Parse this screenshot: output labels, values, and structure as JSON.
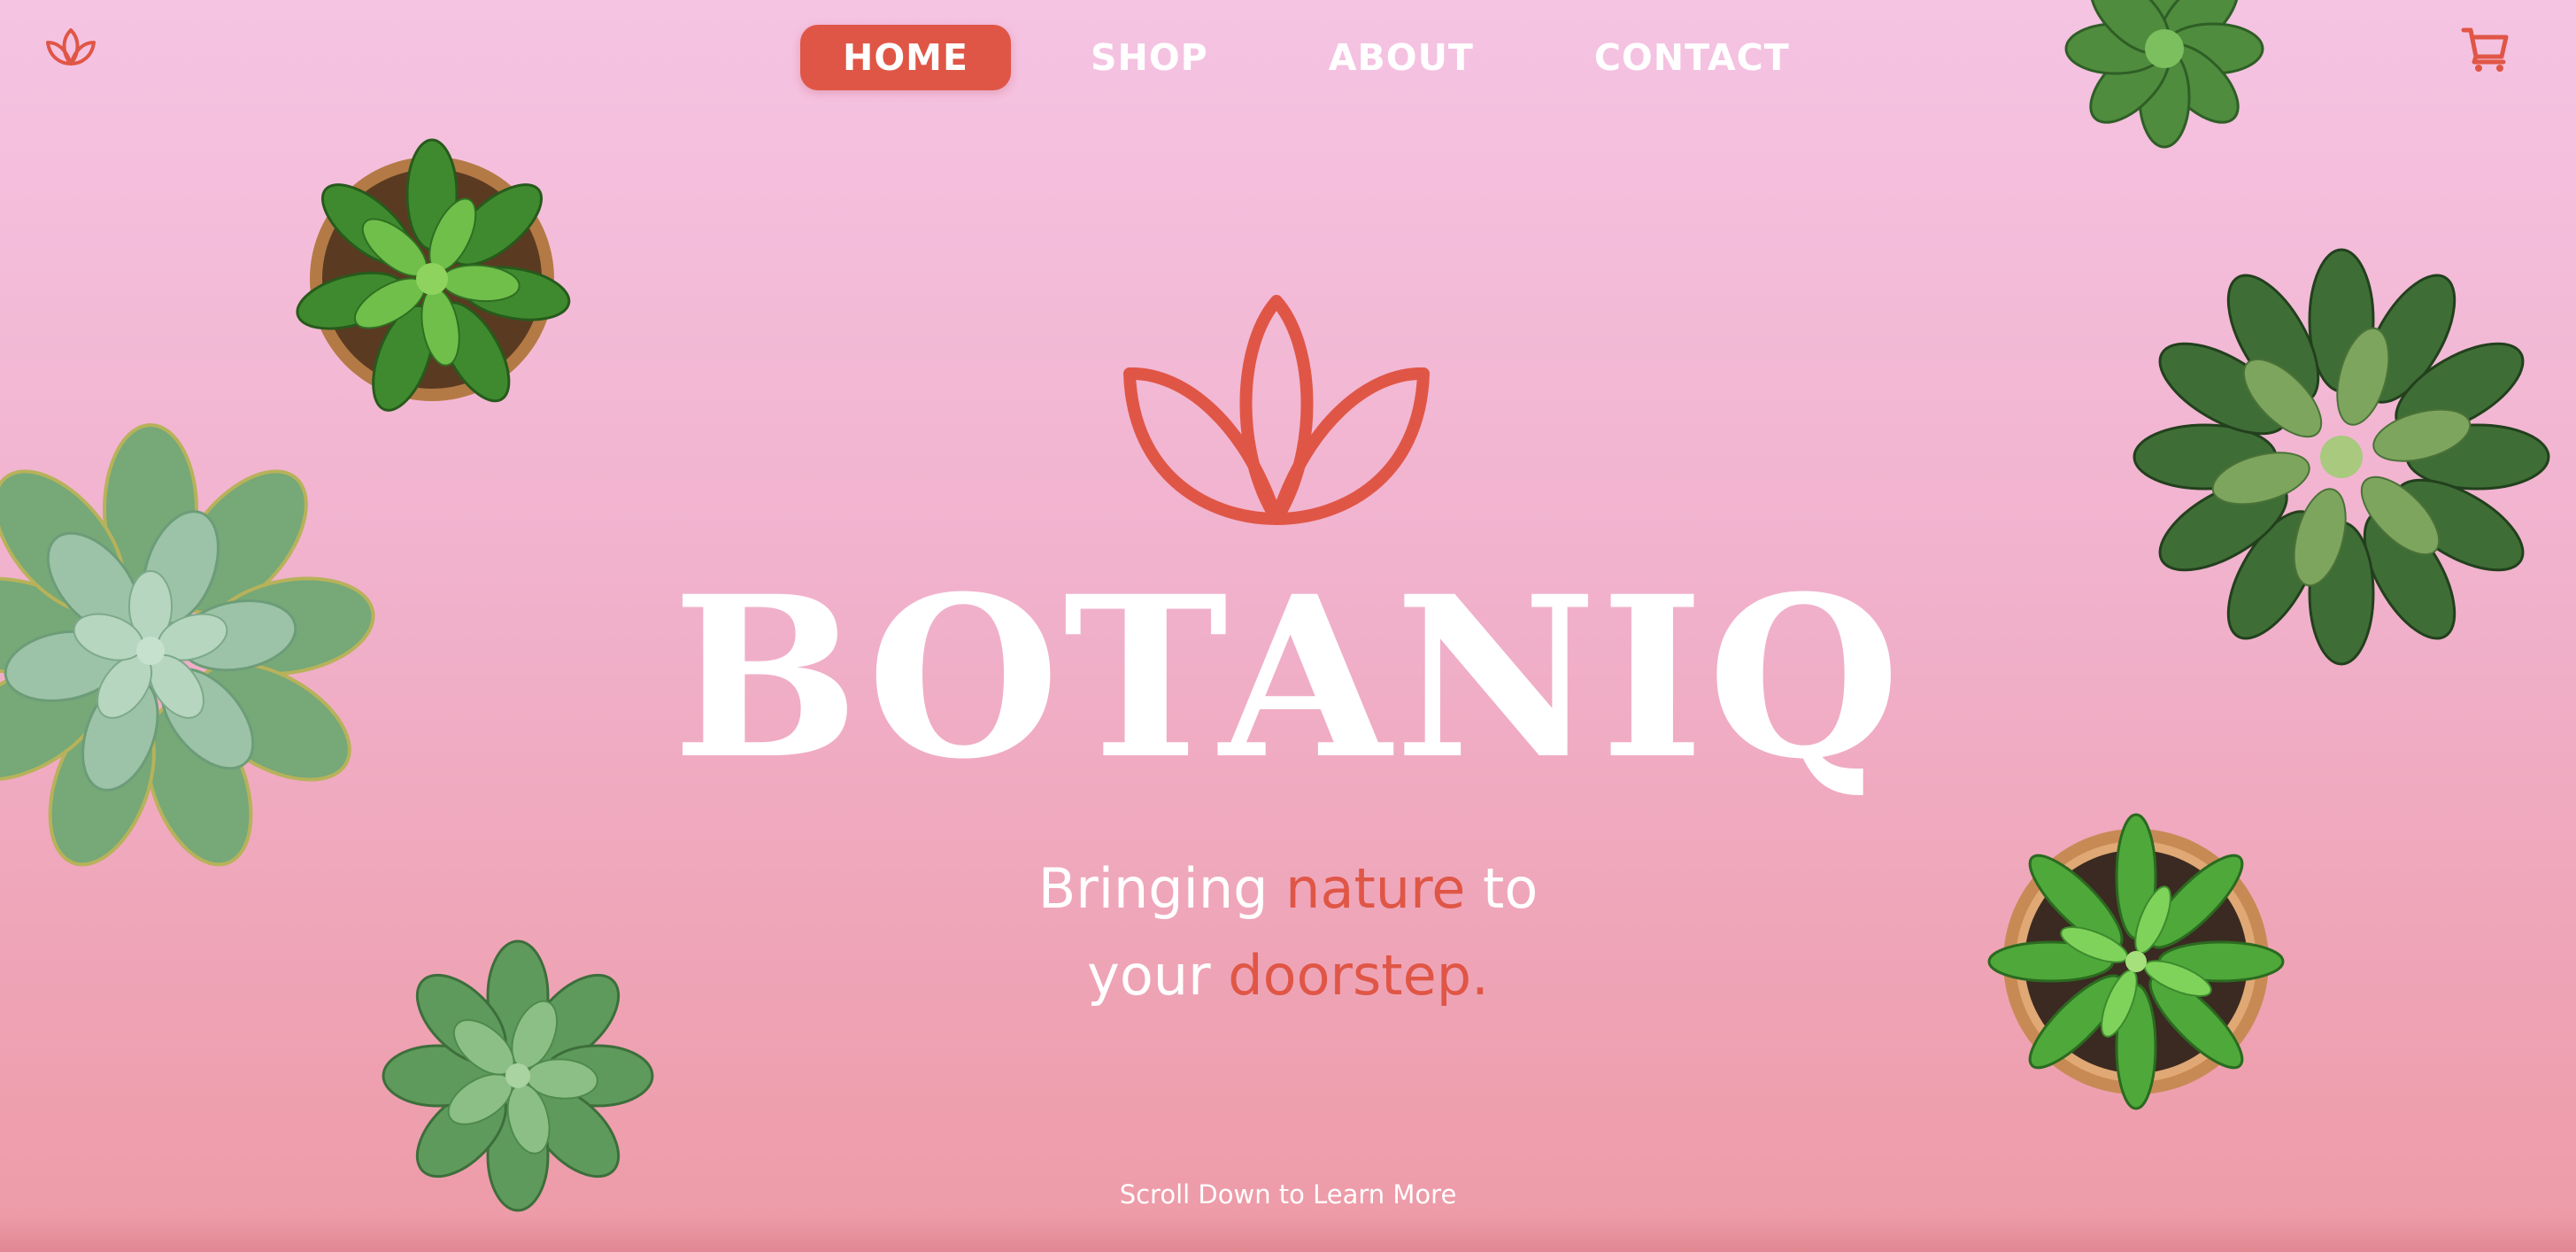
{
  "brand": {
    "name": "BOTANIQ",
    "logo_icon": "lotus-icon",
    "accent_color": "#e05646"
  },
  "nav": {
    "items": [
      {
        "label": "HOME",
        "active": true
      },
      {
        "label": "SHOP",
        "active": false
      },
      {
        "label": "ABOUT",
        "active": false
      },
      {
        "label": "CONTACT",
        "active": false
      }
    ],
    "cart_icon": "shopping-cart-icon"
  },
  "hero": {
    "tagline": {
      "line1_part1": "Bringing ",
      "line1_accent": "nature",
      "line1_part2": " to",
      "line2_part1": "your ",
      "line2_accent": "doorstep."
    },
    "scroll_hint": "Scroll Down to Learn More"
  },
  "decor": {
    "plants": [
      "potted-plant",
      "succulent",
      "succulent",
      "succulent",
      "succulent",
      "potted-succulent",
      "succulent"
    ]
  },
  "colors": {
    "background_top": "#f5c4e3",
    "background_bottom": "#ed9aa6",
    "text": "#ffffff"
  }
}
